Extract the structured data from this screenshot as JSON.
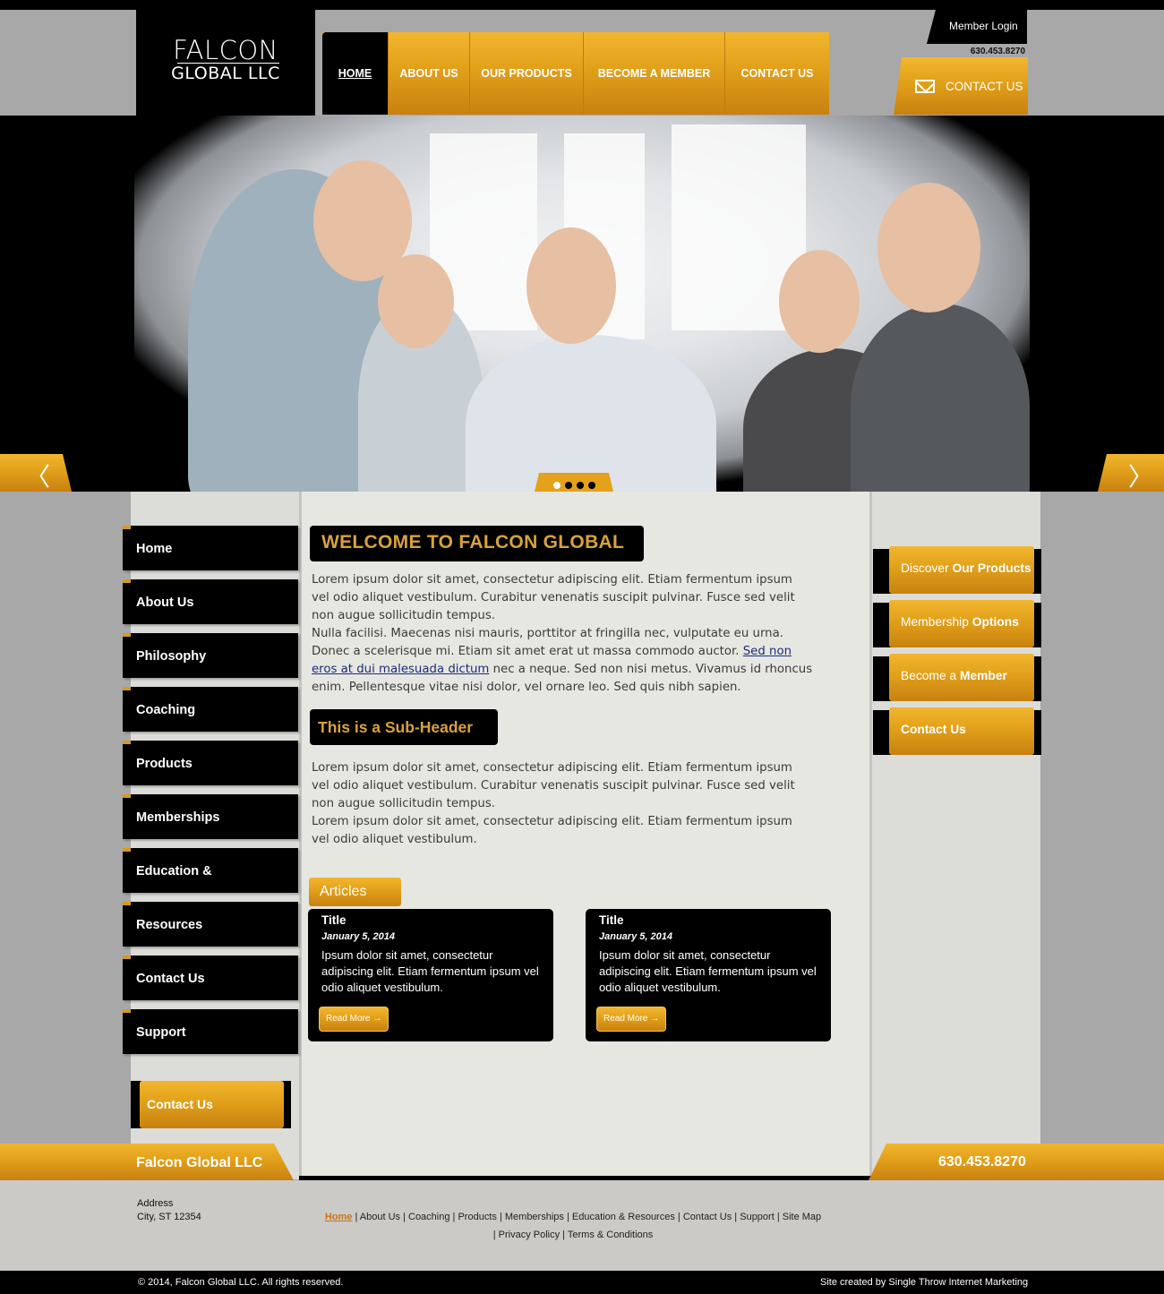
{
  "brand": {
    "line1": "FALCON",
    "line2": "GLOBAL LLC"
  },
  "nav": [
    {
      "label": "HOME",
      "active": true
    },
    {
      "label": "ABOUT US"
    },
    {
      "label": "OUR PRODUCTS"
    },
    {
      "label": "BECOME A MEMBER"
    },
    {
      "label": "CONTACT US"
    }
  ],
  "header": {
    "member_login": "Member Login",
    "phone": "630.453.8270",
    "contact_label": "CONTACT US"
  },
  "slider": {
    "prev_icon": "chevron-left-icon",
    "next_icon": "chevron-right-icon",
    "prev_glyph": "〈",
    "next_glyph": "〉",
    "slides": 4,
    "current": 1
  },
  "sidebar": {
    "items": [
      "Home",
      "About Us",
      "Philosophy",
      "Coaching",
      "Products",
      "Memberships",
      "Education &",
      "Resources",
      "Contact Us",
      "Support"
    ],
    "contact_label": "Contact Us"
  },
  "main": {
    "welcome": "WELCOME TO FALCON GLOBAL",
    "p1": "Lorem ipsum dolor sit amet, consectetur adipiscing elit. Etiam fermentum ipsum vel odio aliquet vestibulum. Curabitur venenatis suscipit pulvinar. Fusce sed velit non augue sollicitudin tempus.",
    "p2_before": "Nulla facilisi. Maecenas nisi mauris, porttitor at fringilla nec, vulputate eu urna. Donec a scelerisque mi. Etiam sit amet erat ut massa commodo auctor. ",
    "p2_link": "Sed non eros at dui malesuada dictum",
    "p2_after": " nec a neque. Sed non nisi metus. Vivamus id rhoncus enim. Pellentesque vitae nisi dolor, vel ornare leo. Sed quis nibh sapien.",
    "subheader": "This is a Sub-Header",
    "p3": "Lorem ipsum dolor sit amet, consectetur adipiscing elit. Etiam fermentum ipsum vel odio aliquet vestibulum. Curabitur venenatis suscipit pulvinar. Fusce sed velit non augue sollicitudin tempus.",
    "p4": "Lorem ipsum dolor sit amet, consectetur adipiscing elit. Etiam fermentum ipsum vel odio aliquet vestibulum.",
    "articles_label": "Articles",
    "articles": [
      {
        "title": "Title",
        "date": "January 5, 2014",
        "body": "Ipsum dolor sit amet, consectetur adipiscing elit. Etiam fermentum ipsum vel odio aliquet vestibulum.",
        "read_more": "Read More →"
      },
      {
        "title": "Title",
        "date": "January 5, 2014",
        "body": "Ipsum dolor sit amet, consectetur adipiscing elit. Etiam fermentum ipsum vel odio aliquet vestibulum.",
        "read_more": "Read More →"
      }
    ]
  },
  "right": [
    {
      "pre": "Discover ",
      "bold": "Our Products"
    },
    {
      "pre": "Membership ",
      "bold": "Options"
    },
    {
      "pre": "Become ",
      "mid": "a ",
      "bold": "Member"
    },
    {
      "pre": "",
      "bold": "Contact Us"
    }
  ],
  "footer": {
    "company": "Falcon Global LLC",
    "phone": "630.453.8270",
    "address1": "Address",
    "address2": "City, ST 12354",
    "links_row1": [
      "Home",
      "About Us",
      "Coaching",
      "Products",
      "Memberships",
      "Education & Resources",
      "Contact Us",
      "Support",
      "Site Map"
    ],
    "links_row2": [
      "Privacy Policy",
      "Terms & Conditions"
    ],
    "copyright": "© 2014, Falcon Global LLC. All rights reserved.",
    "credit": "Site created by Single Throw Internet Marketing"
  },
  "colors": {
    "accent": "#e1a01a",
    "dark": "#000000",
    "link": "#1a2d7a"
  }
}
